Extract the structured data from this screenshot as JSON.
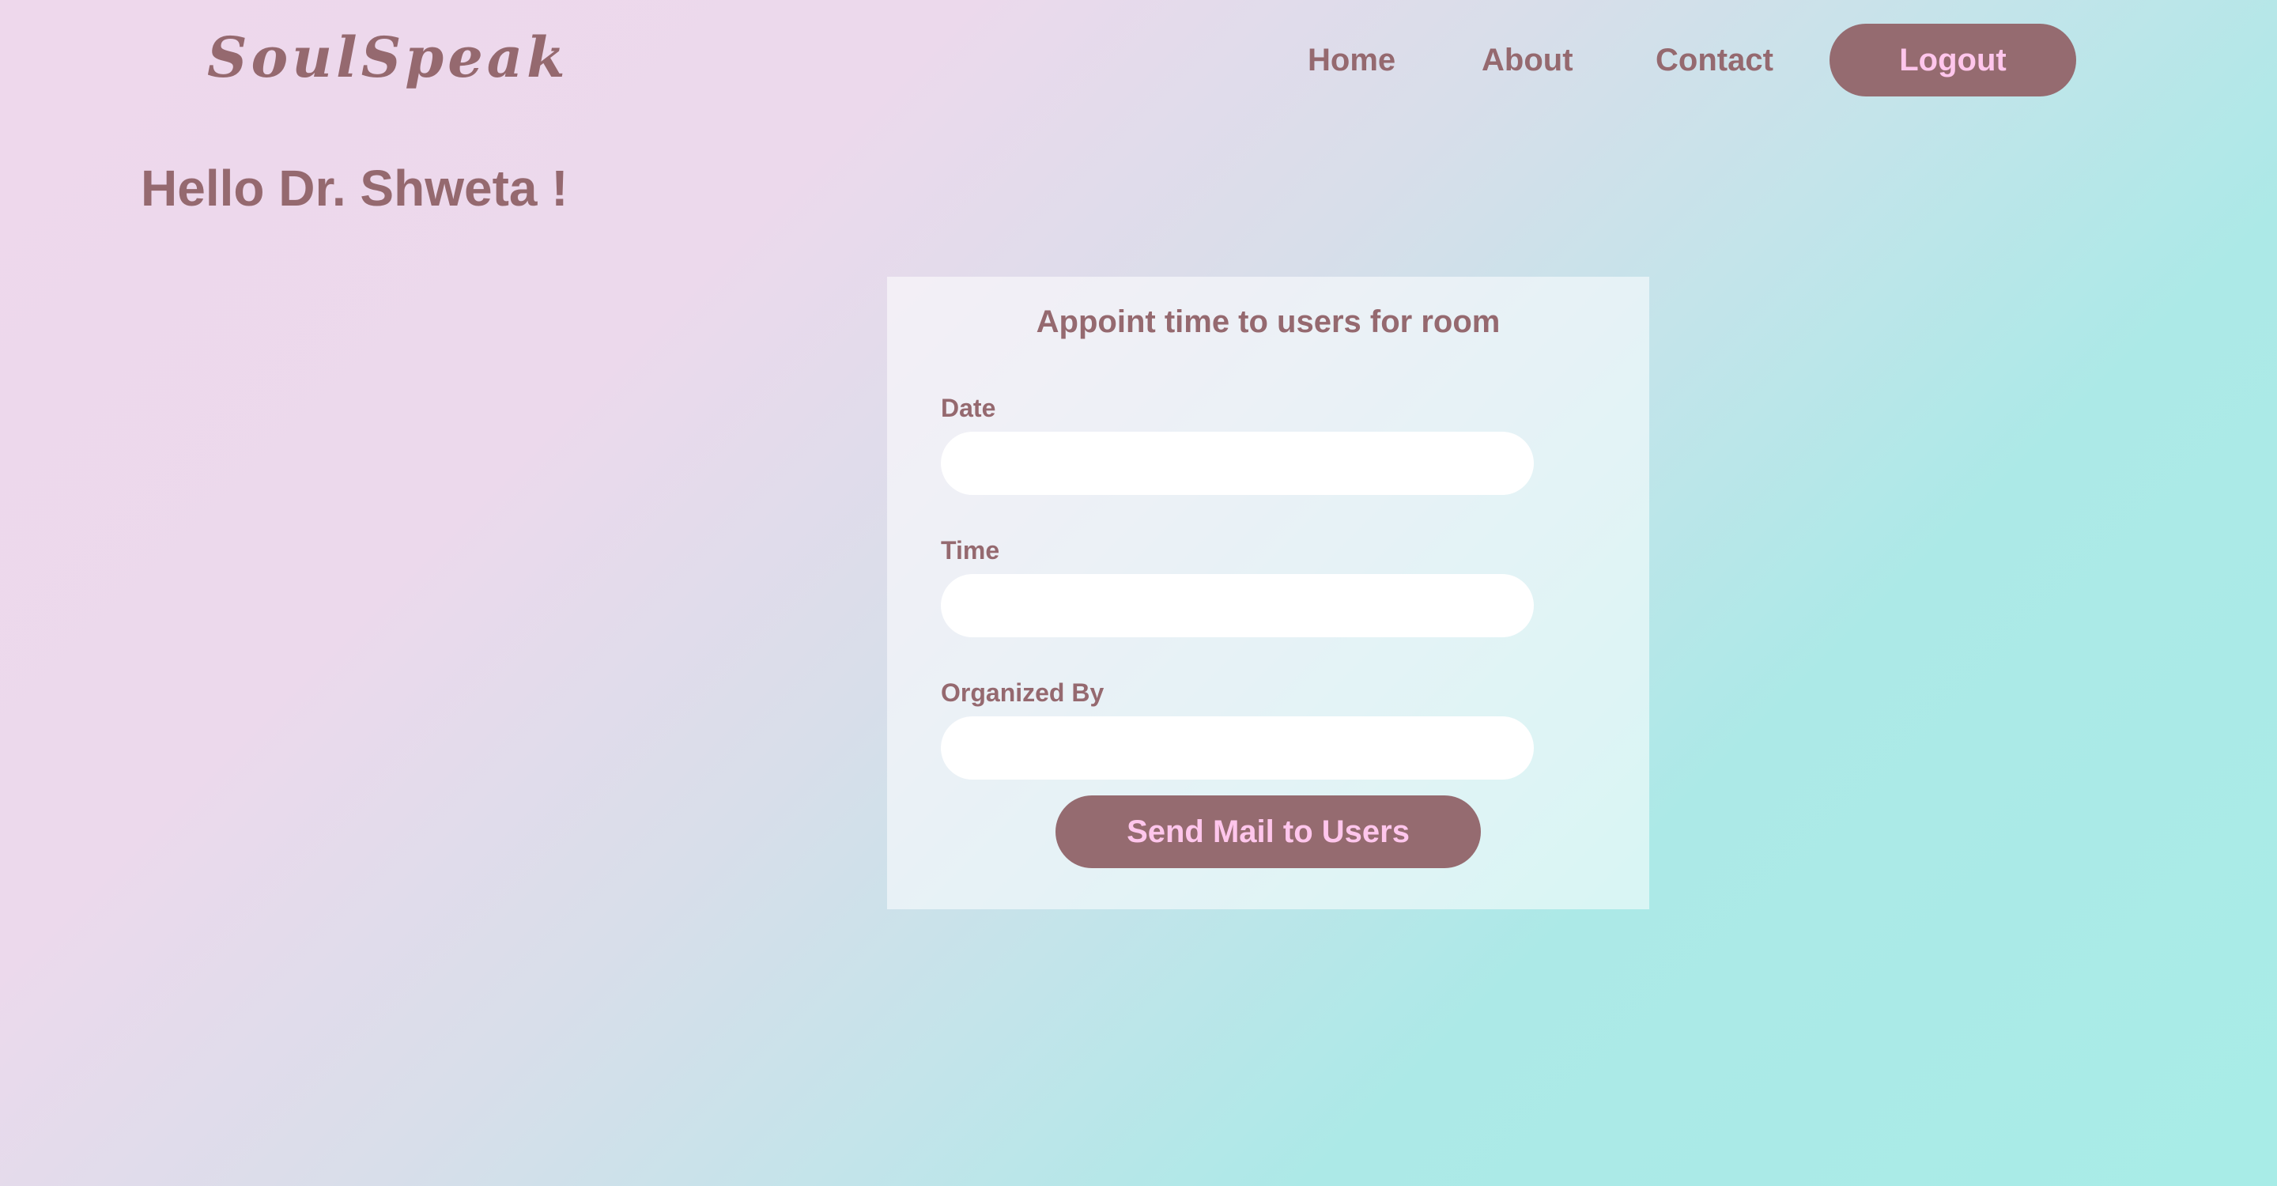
{
  "header": {
    "logo": "SoulSpeak",
    "nav": {
      "home": "Home",
      "about": "About",
      "contact": "Contact"
    },
    "logout_label": "Logout"
  },
  "greeting": "Hello Dr. Shweta !",
  "form": {
    "title": "Appoint time to users for room",
    "fields": {
      "date": {
        "label": "Date",
        "value": ""
      },
      "time": {
        "label": "Time",
        "value": ""
      },
      "organized_by": {
        "label": "Organized By",
        "value": ""
      }
    },
    "submit_label": "Send Mail to Users"
  },
  "colors": {
    "primary_text": "#95696f",
    "button_bg": "#956b70",
    "button_text": "#ffc6ec",
    "gradient_start": "#eed8ec",
    "gradient_end": "#a8ece7"
  }
}
